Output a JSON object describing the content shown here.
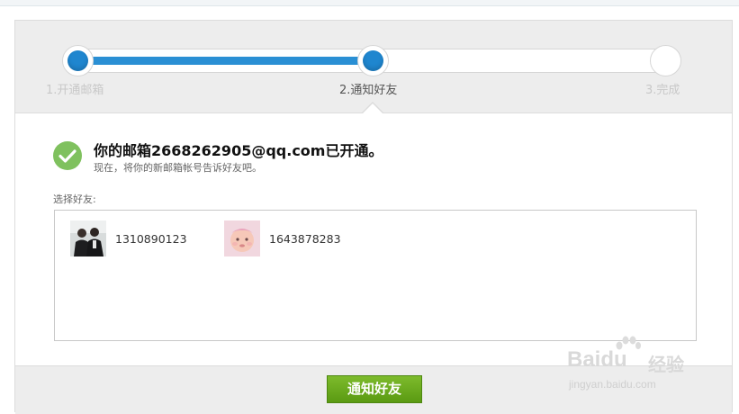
{
  "stepper": {
    "progress": 0.5,
    "steps": [
      {
        "label": "1.开通邮箱",
        "state": "done"
      },
      {
        "label": "2.通知好友",
        "state": "current"
      },
      {
        "label": "3.完成",
        "state": "pending"
      }
    ]
  },
  "message": {
    "headline": "你的邮箱2668262905@qq.com已开通。",
    "subline": "现在，将你的新邮箱帐号告诉好友吧。"
  },
  "friends": {
    "label": "选择好友:",
    "items": [
      {
        "id": "1310890123"
      },
      {
        "id": "1643878283"
      }
    ]
  },
  "footer": {
    "notify_button": "通知好友"
  },
  "watermark": {
    "logo": "Baidu",
    "cn": "经验",
    "url": "jingyan.baidu.com"
  },
  "colors": {
    "accent_blue": "#1f86cf",
    "button_green": "#6aa91f",
    "success_green": "#7fc15e"
  }
}
